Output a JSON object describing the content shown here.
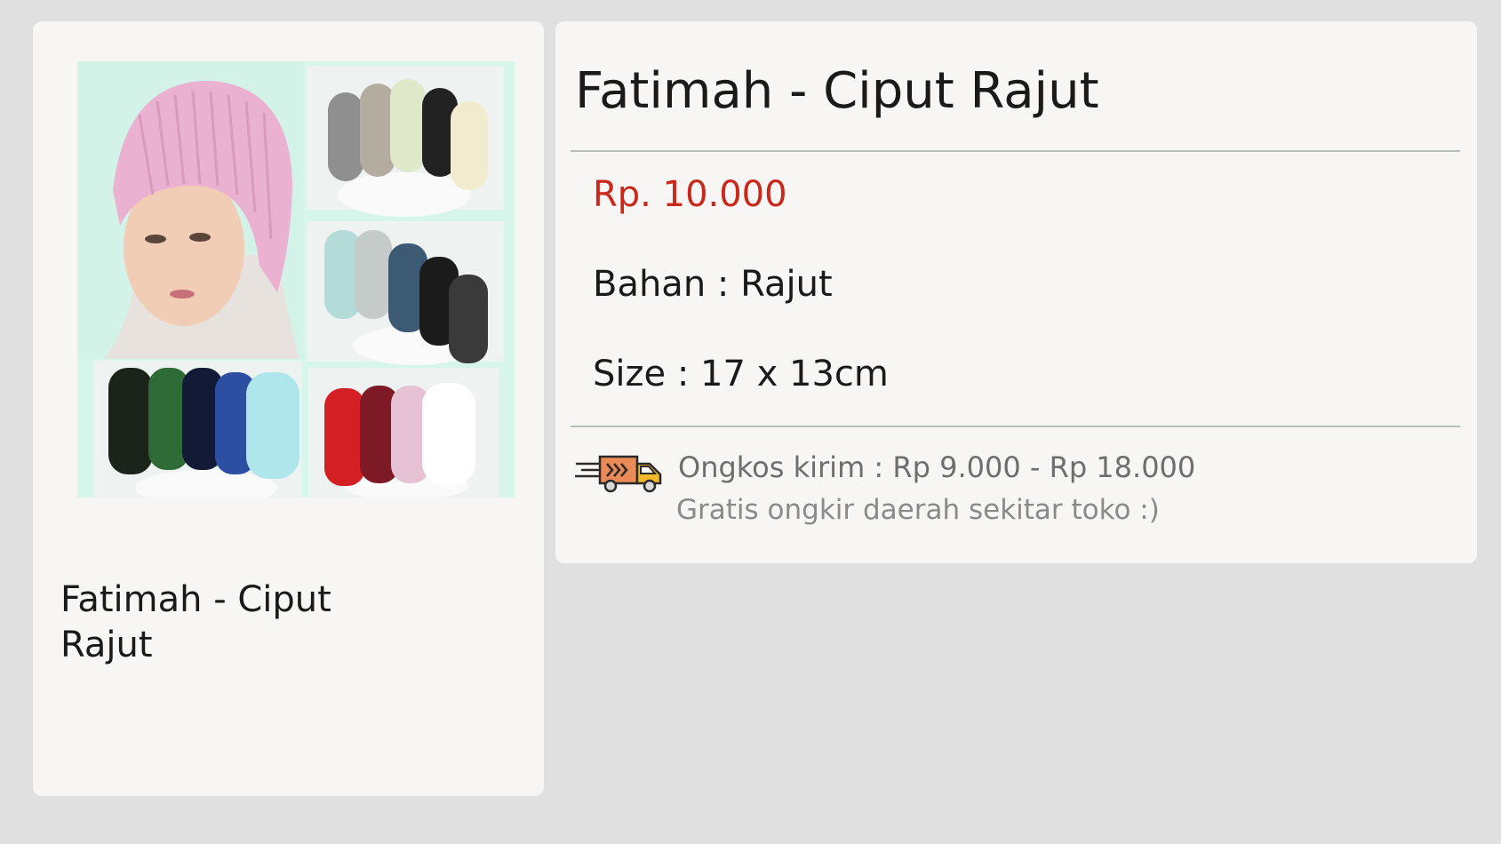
{
  "left_card": {
    "image_alt": "Fatimah - Ciput Rajut product photo",
    "title": "Fatimah - Ciput Rajut"
  },
  "product": {
    "title": "Fatimah - Ciput Rajut",
    "price": "Rp. 10.000",
    "material": "Bahan : Rajut",
    "size": "Size : 17 x 13cm"
  },
  "shipping": {
    "icon": "delivery-truck-icon",
    "cost": "Ongkos kirim : Rp 9.000 - Rp 18.000",
    "note": "Gratis ongkir daerah sekitar toko :)"
  },
  "colors": {
    "background": "#e0e0e0",
    "card": "#f7f6f5",
    "price": "#c9281b",
    "divider": "#b9bfbd",
    "muted_text": "#6e6e6e",
    "truck_body": "#e98a57",
    "truck_cab": "#f3b92b"
  }
}
